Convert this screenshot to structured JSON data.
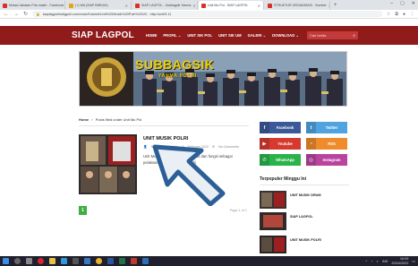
{
  "browser": {
    "tabs": [
      {
        "label": "Mutasi Jabatan Pria masih - Facebook",
        "color": "#d93025",
        "active": false
      },
      {
        "label": "(+) WA (SIAP BIRKAS)",
        "color": "#e8a317",
        "active": false
      },
      {
        "label": "SIAP LAGPOL - Subbagsik Yanma",
        "color": "#d93025",
        "active": false
      },
      {
        "label": "Unit Mu Pol - SIAP LAGPOL",
        "color": "#d93025",
        "active": true
      },
      {
        "label": "STRUKTUR ORGANISASI - Sumber",
        "color": "#d93025",
        "active": false
      }
    ],
    "new_tab": "+",
    "window_controls": [
      "–",
      "▢",
      "✕"
    ],
    "url": "siaplagpolrisdigpoli.com/rowe/Kutsinti/Unit%20Musik%20Polri%20/20 - http://unit/5.11"
  },
  "site": {
    "logo": "SIAP LAGPOL",
    "nav": [
      "HOME",
      "PROFIL ⌄",
      "UNIT SIK POL",
      "UNIT SIK UM",
      "GALERI ⌄",
      "DOWNLOAD ⌄"
    ],
    "search_placeholder": "Cari berita",
    "search_icon": "search-icon"
  },
  "banner": {
    "title": "SUBBAGSIK",
    "subtitle": "YANMA POLRI"
  },
  "breadcrumb": {
    "home": "Home",
    "sep": "›",
    "current": "Posts filed under Unit Mu Pol"
  },
  "post": {
    "title": "UNIT MUSIK POLRI",
    "author": "Siap Lagpol Admin",
    "date": "February 2022",
    "comments": "No Comments",
    "excerpt": "Unit Musik Polri mempunyai tugas dan fungsi sebagai pelaksana di bidang musik Polri"
  },
  "pagination": {
    "current": "1",
    "page_of": "Page 1 of 1"
  },
  "social": [
    {
      "label": "Facebook",
      "icon": "f",
      "color": "#3b5998"
    },
    {
      "label": "Twitter",
      "icon": "t",
      "color": "#4fa3e0"
    },
    {
      "label": "Youtube",
      "icon": "▶",
      "color": "#d63a2f"
    },
    {
      "label": "RSS",
      "icon": "◔",
      "color": "#ef8b2c"
    },
    {
      "label": "WhatsApp",
      "icon": "✆",
      "color": "#29b34a"
    },
    {
      "label": "Instagram",
      "icon": "◎",
      "color": "#b9449f"
    }
  ],
  "popular": {
    "heading": "Terpopuler Minggu Ini",
    "items": [
      {
        "title": "UNIT MUSIK DRUM"
      },
      {
        "title": "SIAP LAGPOL"
      },
      {
        "title": "UNIT MUSIK POLRI"
      }
    ]
  },
  "taskbar": {
    "time": "16:09",
    "date": "20/04/2022",
    "lang": "IND"
  }
}
